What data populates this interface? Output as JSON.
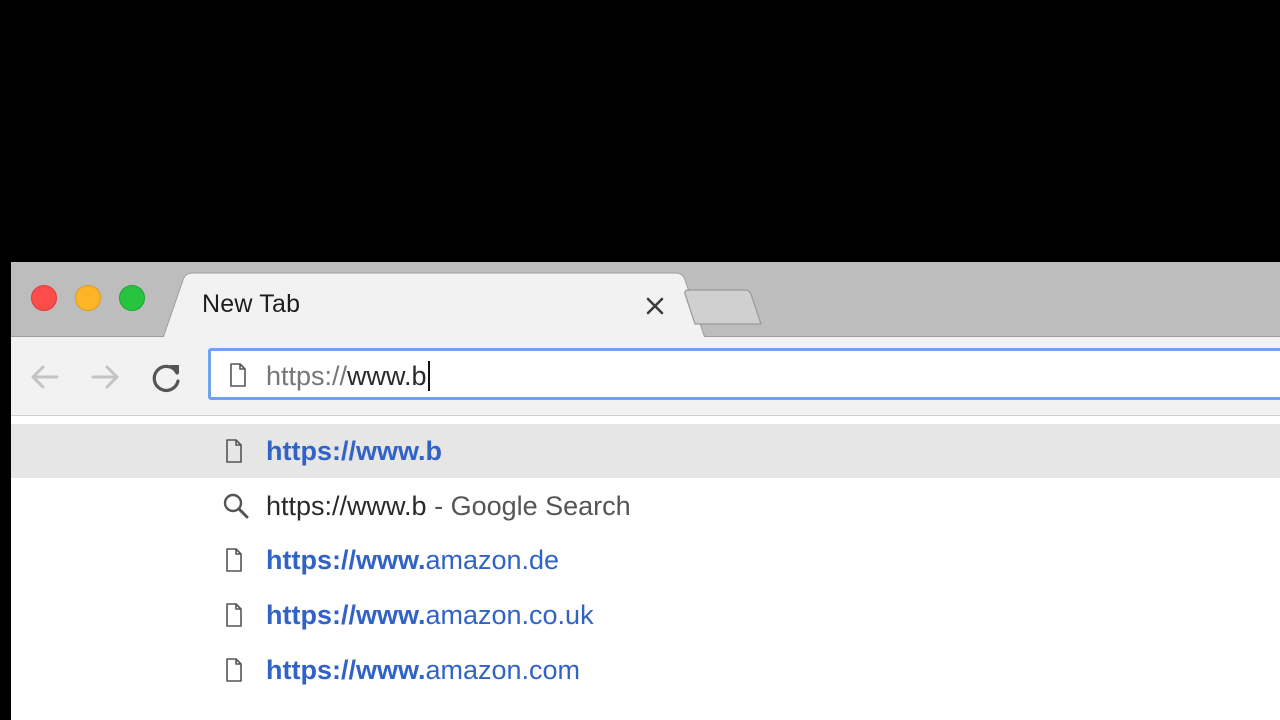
{
  "window": {
    "controls": [
      "close",
      "minimize",
      "maximize"
    ]
  },
  "tab": {
    "title": "New Tab",
    "close_icon": "close-icon"
  },
  "toolbar": {
    "back_icon": "back-arrow-icon",
    "forward_icon": "forward-arrow-icon",
    "reload_icon": "reload-icon"
  },
  "omnibox": {
    "scheme": "https://",
    "host": "www.b",
    "value": "https://www.b",
    "icon": "page-icon"
  },
  "suggestions": [
    {
      "icon": "page-icon",
      "kind": "url",
      "bold": "https://www.b",
      "rest": "",
      "selected": true
    },
    {
      "icon": "search-icon",
      "kind": "search",
      "query": "https://www.b",
      "suffix": " - Google Search",
      "selected": false
    },
    {
      "icon": "page-icon",
      "kind": "url",
      "bold": "https://www.",
      "rest": "amazon.de",
      "selected": false
    },
    {
      "icon": "page-icon",
      "kind": "url",
      "bold": "https://www.",
      "rest": "amazon.co.uk",
      "selected": false
    },
    {
      "icon": "page-icon",
      "kind": "url",
      "bold": "https://www.",
      "rest": "amazon.com",
      "selected": false
    }
  ],
  "colors": {
    "link_blue": "#3163c6",
    "focus_ring": "#6ea3ee",
    "selected_row": "#e6e6e6"
  }
}
